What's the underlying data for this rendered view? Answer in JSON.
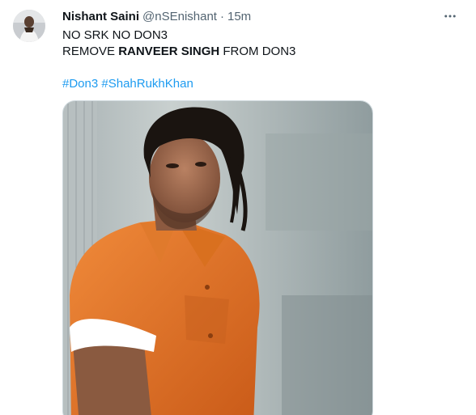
{
  "author": {
    "display_name": "Nishant Saini",
    "handle": "@nSEnishant",
    "separator": "·",
    "time": "15m"
  },
  "tweet": {
    "line1": "NO SRK NO DON3",
    "line2_prefix": "REMOVE ",
    "line2_bold": "RANVEER SINGH",
    "line2_suffix": " FROM DON3",
    "hashtags": [
      "#Don3",
      "#ShahRukhKhan"
    ]
  },
  "icons": {
    "more": "more-options-icon"
  },
  "colors": {
    "link": "#1d9bf0",
    "secondary_text": "#536471",
    "primary_text": "#0f1419",
    "shirt": "#e8742a"
  }
}
